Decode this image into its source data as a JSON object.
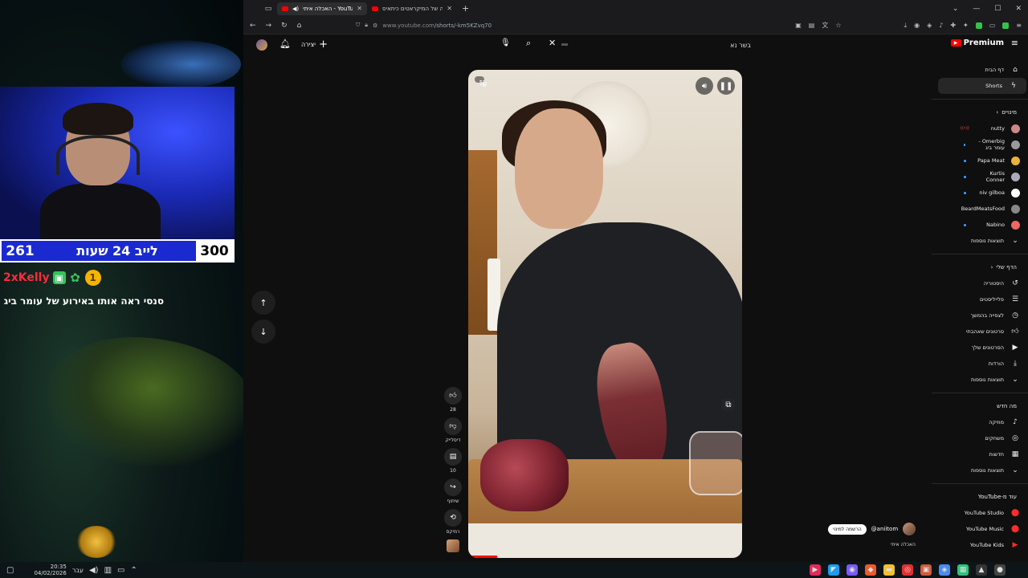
{
  "stream": {
    "counter_left": "261",
    "counter_title": "לייב 24 שעות",
    "counter_right": "300",
    "chat_username": "2xKelly",
    "chat_badge_coin": "1",
    "chat_message": "סנסי ראה אותו באירוע של עומר ביג"
  },
  "taskbar": {
    "time": "20:35",
    "date": "04/02/2026",
    "lang": "עבר"
  },
  "browser": {
    "tabs": [
      {
        "label": "האכלה איתי - YouTube",
        "active": true
      },
      {
        "label": "הבעיה של המיקראטים כיתאיס",
        "active": false
      }
    ],
    "url_host": "www.youtube.com",
    "url_path": "/shorts/-km5KZvq70"
  },
  "youtube": {
    "create_label": "יצירה",
    "search_value": "בשר נא",
    "logo_label": "Premium",
    "sidebar": {
      "home": "דף הבית",
      "shorts": "Shorts",
      "subs_title": "מינויים",
      "subscriptions": [
        {
          "name": "nutty",
          "live": true,
          "color": "#c88"
        },
        {
          "name": "Omerbig - עומר ביג",
          "live": false,
          "color": "#999"
        },
        {
          "name": "Papa Meat",
          "live": false,
          "color": "#e9b23a"
        },
        {
          "name": "Kurtis Conner",
          "live": false,
          "color": "#aab"
        },
        {
          "name": "niv gilboa",
          "live": false,
          "color": "#fff"
        },
        {
          "name": "BeardMeatsFood",
          "live": false,
          "color": "#888"
        },
        {
          "name": "Nabino",
          "live": false,
          "color": "#e66"
        }
      ],
      "show_more": "תוצאות נוספות",
      "you_title": "הדף שלי",
      "you_items": [
        "היסטוריה",
        "פלייליסטים",
        "לצפייה בהמשך",
        "סרטונים שאהבתי",
        "הסרטונים שלך",
        "הורדות"
      ],
      "whats_new_title": "מה חדש",
      "whats_new": [
        "מוזיקה",
        "משחקים",
        "חדשות"
      ],
      "more_from": "עוד מ-YouTube",
      "yt_apps": [
        "YouTube Studio",
        "YouTube Music",
        "YouTube Kids"
      ]
    },
    "actions": {
      "likes": "28",
      "dislike": "דיסלייק",
      "comments": "10",
      "share": "שיתוף",
      "remix": "רמיקס"
    },
    "channel": {
      "handle": "@aniitom",
      "subscribe": "הרשמה למינוי",
      "caption": "האכלה איתי"
    }
  }
}
